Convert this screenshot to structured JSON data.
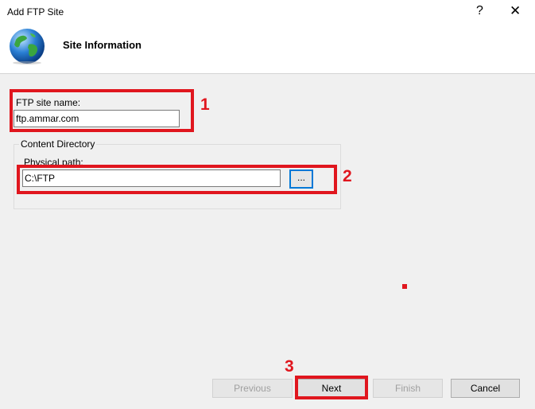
{
  "window": {
    "title": "Add FTP Site",
    "help_glyph": "?",
    "close_glyph": "✕"
  },
  "header": {
    "heading": "Site Information",
    "icon": "globe-icon"
  },
  "form": {
    "site_name_label": "FTP site name:",
    "site_name_value": "ftp.ammar.com",
    "content_directory_label": "Content Directory",
    "physical_path_label": "Physical path:",
    "physical_path_value": "C:\\FTP",
    "browse_label": "..."
  },
  "annotations": {
    "n1": "1",
    "n2": "2",
    "n3": "3",
    "color": "#e0161e"
  },
  "buttons": {
    "previous": "Previous",
    "next": "Next",
    "finish": "Finish",
    "cancel": "Cancel"
  }
}
